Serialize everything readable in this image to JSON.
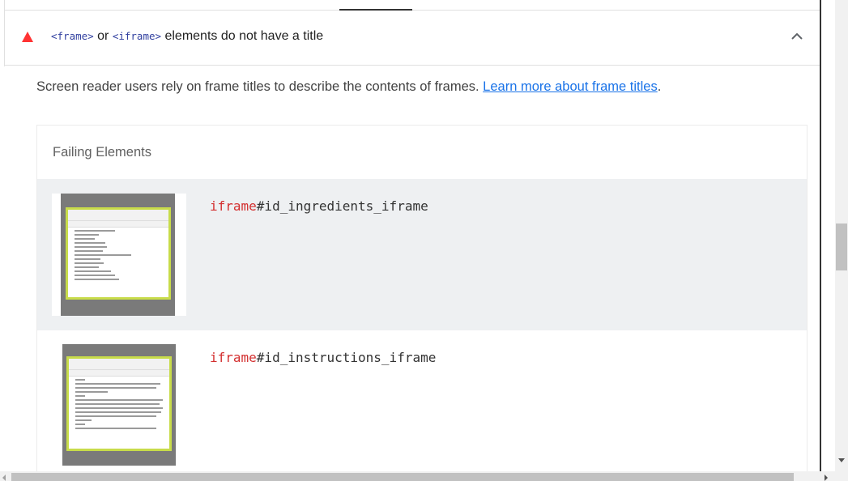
{
  "audit": {
    "title_code_1": "<frame>",
    "title_or": " or ",
    "title_code_2": "<iframe>",
    "title_rest": " elements do not have a title",
    "status_icon": "fail-triangle-icon",
    "status_color": "#ff3333",
    "expand_icon": "chevron-up-icon"
  },
  "description": {
    "text": "Screen reader users rely on frame titles to describe the contents of frames. ",
    "link_text": "Learn more about frame titles",
    "end": "."
  },
  "failing": {
    "heading": "Failing Elements",
    "items": [
      {
        "tag": "iframe",
        "selector": "#id_ingredients_iframe",
        "thumbnail": "ingredients-iframe-screenshot"
      },
      {
        "tag": "iframe",
        "selector": "#id_instructions_iframe",
        "thumbnail": "instructions-iframe-screenshot"
      }
    ]
  },
  "colors": {
    "link": "#1a73e8",
    "code": "#303f9f",
    "tag": "#d32f2f",
    "row_highlight": "#eef0f2",
    "thumbnail_border": "#c8dc4a"
  }
}
